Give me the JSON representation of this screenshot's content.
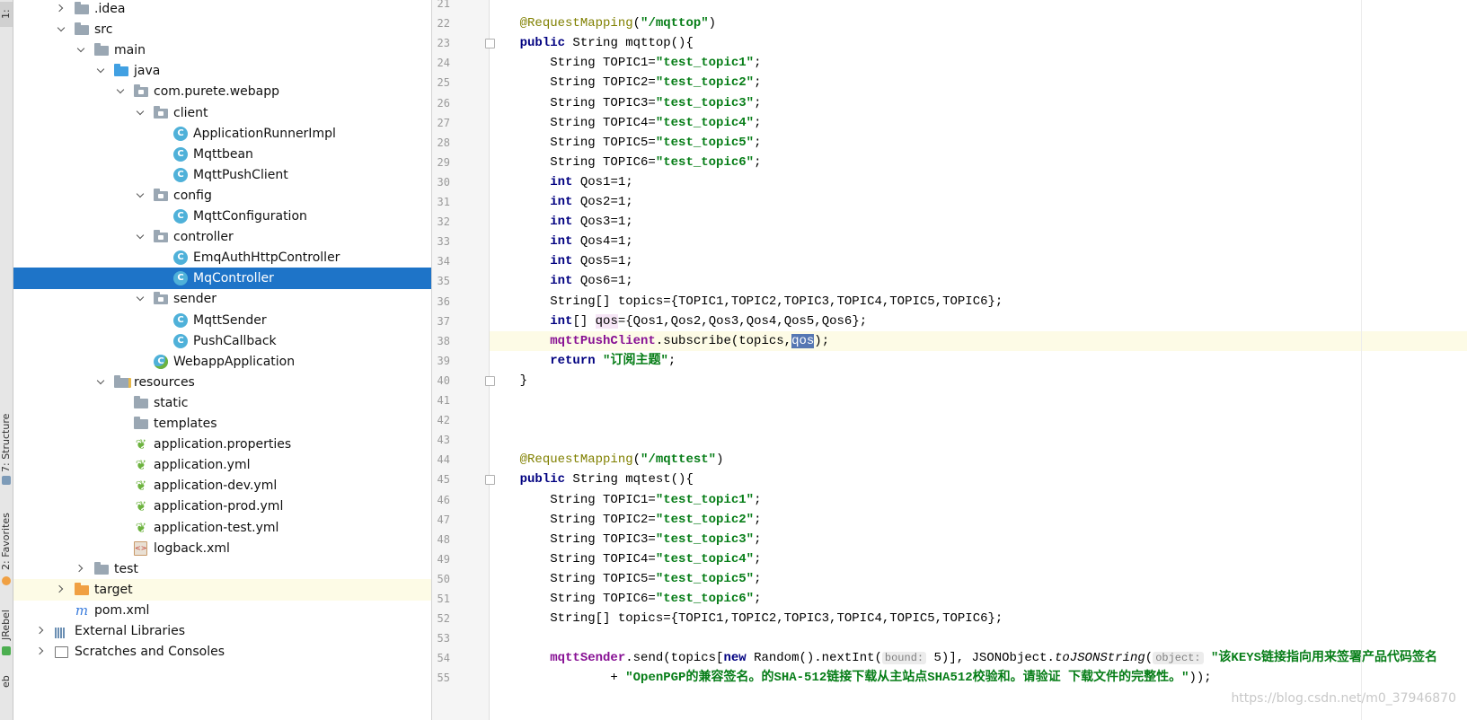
{
  "toolstrip": {
    "structure": "7: Structure",
    "favorites": "2: Favorites",
    "jrebel": "JRebel",
    "web": "eb",
    "top_tab": "1:"
  },
  "tree": [
    {
      "label": ".idea",
      "arrow": "closed",
      "icon": "folder"
    },
    {
      "label": "src",
      "arrow": "open",
      "icon": "folder"
    },
    {
      "label": "main",
      "arrow": "open",
      "icon": "folder"
    },
    {
      "label": "java",
      "arrow": "open",
      "icon": "folder-blue"
    },
    {
      "label": "com.purete.webapp",
      "arrow": "open",
      "icon": "package"
    },
    {
      "label": "client",
      "arrow": "open",
      "icon": "package"
    },
    {
      "label": "ApplicationRunnerImpl",
      "arrow": "",
      "icon": "class"
    },
    {
      "label": "Mqttbean",
      "arrow": "",
      "icon": "class"
    },
    {
      "label": "MqttPushClient",
      "arrow": "",
      "icon": "class"
    },
    {
      "label": "config",
      "arrow": "open",
      "icon": "package"
    },
    {
      "label": "MqttConfiguration",
      "arrow": "",
      "icon": "class"
    },
    {
      "label": "controller",
      "arrow": "open",
      "icon": "package"
    },
    {
      "label": "EmqAuthHttpController",
      "arrow": "",
      "icon": "class"
    },
    {
      "label": "MqController",
      "arrow": "",
      "icon": "class",
      "selected": true
    },
    {
      "label": "sender",
      "arrow": "open",
      "icon": "package"
    },
    {
      "label": "MqttSender",
      "arrow": "",
      "icon": "class"
    },
    {
      "label": "PushCallback",
      "arrow": "",
      "icon": "class"
    },
    {
      "label": "WebappApplication",
      "arrow": "",
      "icon": "spring-class"
    },
    {
      "label": "resources",
      "arrow": "open",
      "icon": "resources"
    },
    {
      "label": "static",
      "arrow": "",
      "icon": "folder"
    },
    {
      "label": "templates",
      "arrow": "",
      "icon": "folder"
    },
    {
      "label": "application.properties",
      "arrow": "",
      "icon": "spring-leaf"
    },
    {
      "label": "application.yml",
      "arrow": "",
      "icon": "spring-leaf"
    },
    {
      "label": "application-dev.yml",
      "arrow": "",
      "icon": "spring-leaf"
    },
    {
      "label": "application-prod.yml",
      "arrow": "",
      "icon": "spring-leaf"
    },
    {
      "label": "application-test.yml",
      "arrow": "",
      "icon": "spring-leaf"
    },
    {
      "label": "logback.xml",
      "arrow": "",
      "icon": "xml"
    },
    {
      "label": "test",
      "arrow": "closed",
      "icon": "folder"
    },
    {
      "label": "target",
      "arrow": "closed",
      "icon": "folder-orange",
      "highlight": true
    },
    {
      "label": "pom.xml",
      "arrow": "",
      "icon": "maven"
    },
    {
      "label": "External Libraries",
      "arrow": "closed",
      "icon": "libraries"
    },
    {
      "label": "Scratches and Consoles",
      "arrow": "closed",
      "icon": "scratches"
    }
  ],
  "line_numbers": [
    "21",
    "22",
    "23",
    "24",
    "25",
    "26",
    "27",
    "28",
    "29",
    "30",
    "31",
    "32",
    "33",
    "34",
    "35",
    "36",
    "37",
    "38",
    "39",
    "40",
    "41",
    "42",
    "43",
    "44",
    "45",
    "46",
    "47",
    "48",
    "49",
    "50",
    "51",
    "52",
    "53",
    "54",
    "55"
  ],
  "code": [
    [],
    [
      {
        "t": "    "
      },
      {
        "t": "@RequestMapping",
        "c": "ann"
      },
      {
        "t": "("
      },
      {
        "t": "\"/mqttop\"",
        "c": "str"
      },
      {
        "t": ")"
      }
    ],
    [
      {
        "t": "    "
      },
      {
        "t": "public",
        "c": "kw"
      },
      {
        "t": " String mqttop(){"
      }
    ],
    [
      {
        "t": "        String TOPIC1="
      },
      {
        "t": "\"test_topic1\"",
        "c": "str"
      },
      {
        "t": ";"
      }
    ],
    [
      {
        "t": "        String TOPIC2="
      },
      {
        "t": "\"test_topic2\"",
        "c": "str"
      },
      {
        "t": ";"
      }
    ],
    [
      {
        "t": "        String TOPIC3="
      },
      {
        "t": "\"test_topic3\"",
        "c": "str"
      },
      {
        "t": ";"
      }
    ],
    [
      {
        "t": "        String TOPIC4="
      },
      {
        "t": "\"test_topic4\"",
        "c": "str"
      },
      {
        "t": ";"
      }
    ],
    [
      {
        "t": "        String TOPIC5="
      },
      {
        "t": "\"test_topic5\"",
        "c": "str"
      },
      {
        "t": ";"
      }
    ],
    [
      {
        "t": "        String TOPIC6="
      },
      {
        "t": "\"test_topic6\"",
        "c": "str"
      },
      {
        "t": ";"
      }
    ],
    [
      {
        "t": "        "
      },
      {
        "t": "int",
        "c": "kw"
      },
      {
        "t": " Qos1=1;"
      }
    ],
    [
      {
        "t": "        "
      },
      {
        "t": "int",
        "c": "kw"
      },
      {
        "t": " Qos2=1;"
      }
    ],
    [
      {
        "t": "        "
      },
      {
        "t": "int",
        "c": "kw"
      },
      {
        "t": " Qos3=1;"
      }
    ],
    [
      {
        "t": "        "
      },
      {
        "t": "int",
        "c": "kw"
      },
      {
        "t": " Qos4=1;"
      }
    ],
    [
      {
        "t": "        "
      },
      {
        "t": "int",
        "c": "kw"
      },
      {
        "t": " Qos5=1;"
      }
    ],
    [
      {
        "t": "        "
      },
      {
        "t": "int",
        "c": "kw"
      },
      {
        "t": " Qos6=1;"
      }
    ],
    [
      {
        "t": "        String[] topics={TOPIC1,TOPIC2,TOPIC3,TOPIC4,TOPIC5,TOPIC6};"
      }
    ],
    [
      {
        "t": "        "
      },
      {
        "t": "int",
        "c": "kw"
      },
      {
        "t": "[] "
      },
      {
        "t": "qos",
        "c": "unused"
      },
      {
        "t": "={Qos1,Qos2,Qos3,Qos4,Qos5,Qos6};"
      }
    ],
    [
      {
        "t": "        "
      },
      {
        "t": "mqttPushClient",
        "c": "fld"
      },
      {
        "t": ".subscribe(topics,"
      },
      {
        "t": "qos",
        "c": "sel"
      },
      {
        "t": ");"
      }
    ],
    [
      {
        "t": "        "
      },
      {
        "t": "return",
        "c": "kw"
      },
      {
        "t": " "
      },
      {
        "t": "\"订阅主题\"",
        "c": "str"
      },
      {
        "t": ";"
      }
    ],
    [
      {
        "t": "    }"
      }
    ],
    [],
    [],
    [],
    [
      {
        "t": "    "
      },
      {
        "t": "@RequestMapping",
        "c": "ann"
      },
      {
        "t": "("
      },
      {
        "t": "\"/mqttest\"",
        "c": "str"
      },
      {
        "t": ")"
      }
    ],
    [
      {
        "t": "    "
      },
      {
        "t": "public",
        "c": "kw"
      },
      {
        "t": " String mqtest(){"
      }
    ],
    [
      {
        "t": "        String TOPIC1="
      },
      {
        "t": "\"test_topic1\"",
        "c": "str"
      },
      {
        "t": ";"
      }
    ],
    [
      {
        "t": "        String TOPIC2="
      },
      {
        "t": "\"test_topic2\"",
        "c": "str"
      },
      {
        "t": ";"
      }
    ],
    [
      {
        "t": "        String TOPIC3="
      },
      {
        "t": "\"test_topic3\"",
        "c": "str"
      },
      {
        "t": ";"
      }
    ],
    [
      {
        "t": "        String TOPIC4="
      },
      {
        "t": "\"test_topic4\"",
        "c": "str"
      },
      {
        "t": ";"
      }
    ],
    [
      {
        "t": "        String TOPIC5="
      },
      {
        "t": "\"test_topic5\"",
        "c": "str"
      },
      {
        "t": ";"
      }
    ],
    [
      {
        "t": "        String TOPIC6="
      },
      {
        "t": "\"test_topic6\"",
        "c": "str"
      },
      {
        "t": ";"
      }
    ],
    [
      {
        "t": "        String[] topics={TOPIC1,TOPIC2,TOPIC3,TOPIC4,TOPIC5,TOPIC6};"
      }
    ],
    [],
    [
      {
        "t": "        "
      },
      {
        "t": "mqttSender",
        "c": "fld"
      },
      {
        "t": ".send(topics["
      },
      {
        "t": "new",
        "c": "kw"
      },
      {
        "t": " Random().nextInt("
      },
      {
        "t": "bound:",
        "c": "hint"
      },
      {
        "t": " 5)], JSONObject."
      },
      {
        "t": "toJSONString",
        "c": "it"
      },
      {
        "t": "("
      },
      {
        "t": "object:",
        "c": "hint"
      },
      {
        "t": " "
      },
      {
        "t": "\"该KEYS链接指向用来签署产品代码签名",
        "c": "str"
      }
    ],
    [
      {
        "t": "                + "
      },
      {
        "t": "\"OpenPGP的兼容签名。的SHA-512链接下载从主站点SHA512校验和。请验证 下载文件的完整性。\"",
        "c": "str"
      },
      {
        "t": "));"
      }
    ]
  ],
  "current_line_index": 17,
  "watermark": "https://blog.csdn.net/m0_37946870"
}
